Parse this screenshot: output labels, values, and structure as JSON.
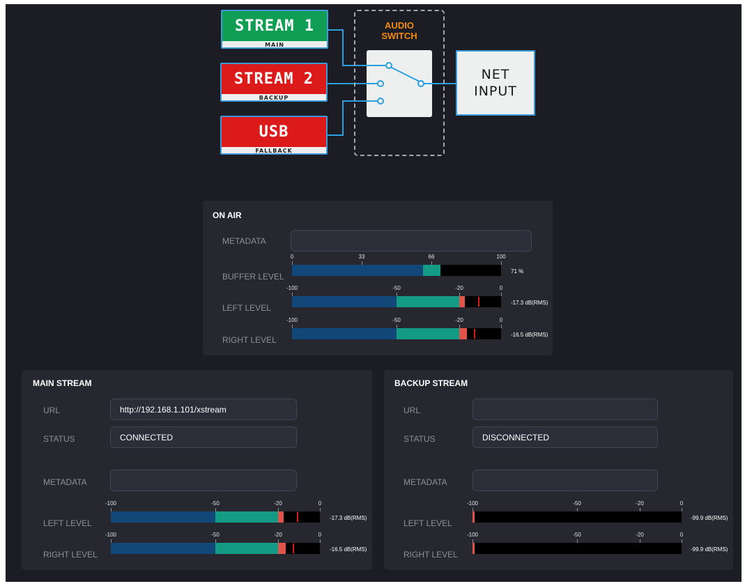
{
  "diagram": {
    "sources": [
      {
        "title": "STREAM 1",
        "subtitle": "MAIN",
        "color": "#0f9e54"
      },
      {
        "title": "STREAM 2",
        "subtitle": "BACKUP",
        "color": "#dc1a1a"
      },
      {
        "title": "USB",
        "subtitle": "FALLBACK",
        "color": "#dc1a1a"
      }
    ],
    "switch_title_1": "AUDIO",
    "switch_title_2": "SWITCH",
    "output_line_1": "NET",
    "output_line_2": "INPUT",
    "active_source": "STREAM 1",
    "wire_color": "#2aa0e0",
    "switch_title_color": "#f08a10"
  },
  "on_air": {
    "title": "ON AIR",
    "metadata_label": "METADATA",
    "metadata_value": "",
    "buffer_label": "BUFFER LEVEL",
    "buffer_ticks": [
      "0",
      "33",
      "66",
      "100"
    ],
    "buffer_percent": 71,
    "buffer_readout": "71 %",
    "left_label": "LEFT LEVEL",
    "right_label": "RIGHT LEVEL",
    "level_ticks": [
      "-100",
      "-50",
      "-20",
      "0"
    ],
    "left_level_db": -17.3,
    "left_peak_db": -11,
    "left_readout": "-17.3 dB(RMS)",
    "right_level_db": -16.5,
    "right_peak_db": -13,
    "right_readout": "-16.5 dB(RMS)"
  },
  "main_stream": {
    "title": "MAIN STREAM",
    "url_label": "URL",
    "url_value": "http://192.168.1.101/xstream",
    "status_label": "STATUS",
    "status_value": "CONNECTED",
    "metadata_label": "METADATA",
    "metadata_value": "",
    "left_label": "LEFT LEVEL",
    "right_label": "RIGHT LEVEL",
    "level_ticks": [
      "-100",
      "-50",
      "-20",
      "0"
    ],
    "left_level_db": -17.3,
    "left_peak_db": -11,
    "left_readout": "-17.3 dB(RMS)",
    "right_level_db": -16.5,
    "right_peak_db": -13,
    "right_readout": "-16.5 dB(RMS)"
  },
  "backup_stream": {
    "title": "BACKUP STREAM",
    "url_label": "URL",
    "url_value": "",
    "status_label": "STATUS",
    "status_value": "DISCONNECTED",
    "metadata_label": "METADATA",
    "metadata_value": "",
    "left_label": "LEFT LEVEL",
    "right_label": "RIGHT LEVEL",
    "level_ticks": [
      "-100",
      "-50",
      "-20",
      "0"
    ],
    "left_level_db": -99.9,
    "left_readout": "-99.9 dB(RMS)",
    "right_level_db": -99.9,
    "right_readout": "-99.9 dB(RMS)"
  }
}
